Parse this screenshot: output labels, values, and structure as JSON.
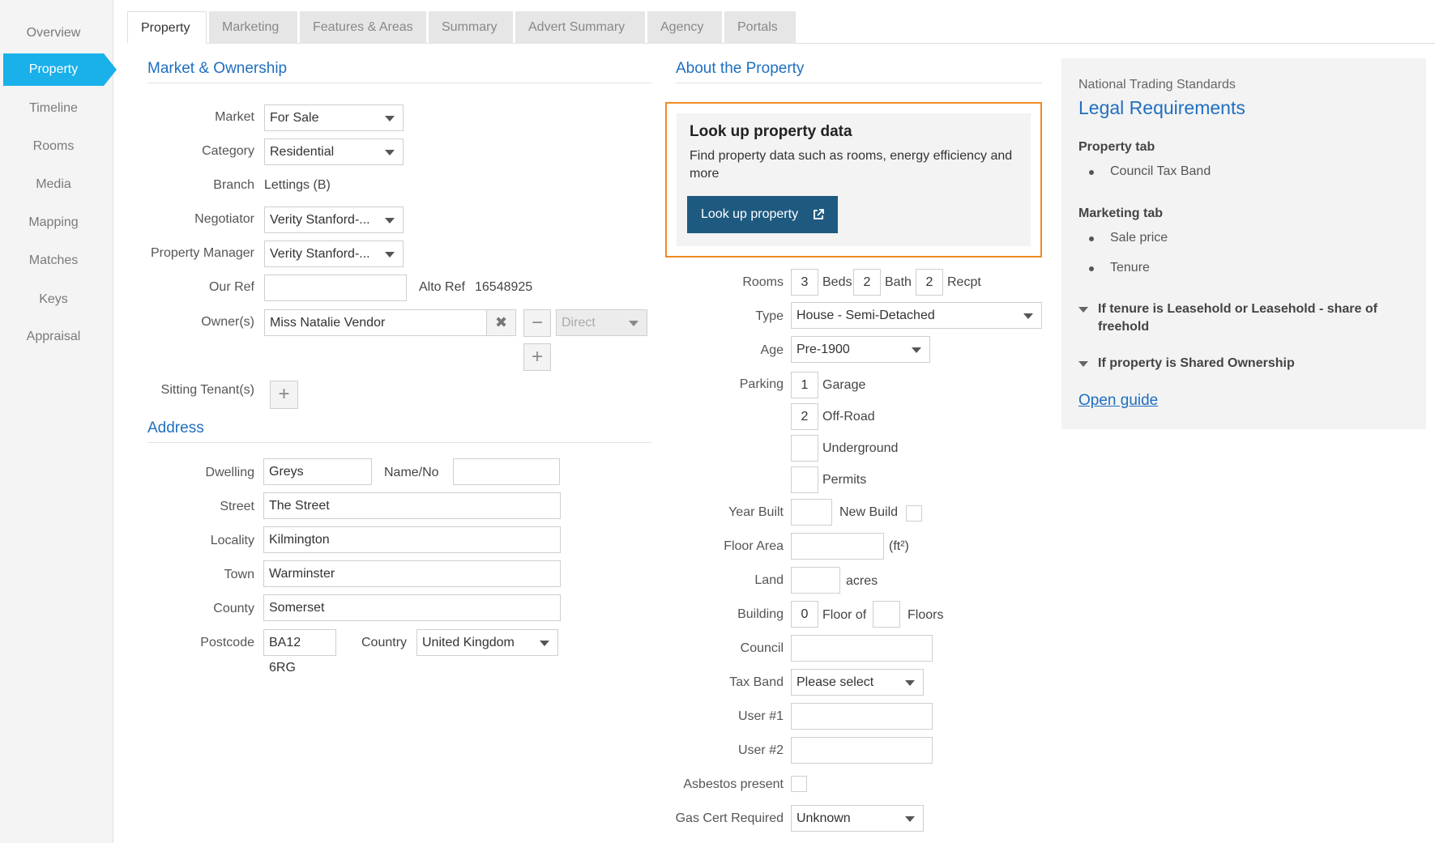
{
  "sidebar": {
    "items": [
      {
        "label": "Overview"
      },
      {
        "label": "Property"
      },
      {
        "label": "Timeline"
      },
      {
        "label": "Rooms"
      },
      {
        "label": "Media"
      },
      {
        "label": "Mapping"
      },
      {
        "label": "Matches"
      },
      {
        "label": "Keys"
      },
      {
        "label": "Appraisal"
      }
    ],
    "active": "Property"
  },
  "tabs": [
    {
      "label": "Property"
    },
    {
      "label": "Marketing"
    },
    {
      "label": "Features & Areas"
    },
    {
      "label": "Summary"
    },
    {
      "label": "Advert Summary"
    },
    {
      "label": "Agency"
    },
    {
      "label": "Portals"
    }
  ],
  "market_ownership": {
    "title": "Market & Ownership",
    "market_label": "Market",
    "market_value": "For Sale",
    "category_label": "Category",
    "category_value": "Residential",
    "branch_label": "Branch",
    "branch_value": "Lettings (B)",
    "negotiator_label": "Negotiator",
    "negotiator_value": "Verity Stanford-...",
    "manager_label": "Property Manager",
    "manager_value": "Verity Stanford-...",
    "our_ref_label": "Our Ref",
    "our_ref_value": "",
    "alto_ref_label": "Alto Ref",
    "alto_ref_value": "16548925",
    "owners_label": "Owner(s)",
    "owner_value": "Miss Natalie Vendor",
    "owner_type": "Direct",
    "sitting_tenants_label": "Sitting Tenant(s)"
  },
  "address": {
    "title": "Address",
    "dwelling_label": "Dwelling",
    "dwelling_value": "Greys",
    "name_no_label": "Name/No",
    "name_no_value": "",
    "street_label": "Street",
    "street_value": "The Street",
    "locality_label": "Locality",
    "locality_value": "Kilmington",
    "town_label": "Town",
    "town_value": "Warminster",
    "county_label": "County",
    "county_value": "Somerset",
    "postcode_label": "Postcode",
    "postcode_value": "BA12 6RG",
    "country_label": "Country",
    "country_value": "United Kingdom"
  },
  "about": {
    "title": "About the Property",
    "lookup": {
      "title": "Look up property data",
      "description": "Find property data such as rooms, energy efficiency and more",
      "button": "Look up property"
    },
    "rooms_label": "Rooms",
    "beds_value": "3",
    "beds_label": "Beds",
    "bath_value": "2",
    "bath_label": "Bath",
    "recpt_value": "2",
    "recpt_label": "Recpt",
    "type_label": "Type",
    "type_value": "House - Semi-Detached",
    "age_label": "Age",
    "age_value": "Pre-1900",
    "parking_label": "Parking",
    "garage_value": "1",
    "garage_label": "Garage",
    "offroad_value": "2",
    "offroad_label": "Off-Road",
    "underground_value": "",
    "underground_label": "Underground",
    "permits_value": "",
    "permits_label": "Permits",
    "year_built_label": "Year Built",
    "year_built_value": "",
    "new_build_label": "New Build",
    "floor_area_label": "Floor Area",
    "floor_area_value": "",
    "floor_area_unit": "(ft²)",
    "land_label": "Land",
    "land_value": "",
    "land_unit": "acres",
    "building_label": "Building",
    "building_floor_value": "0",
    "floor_of_label": "Floor of",
    "floors_value": "",
    "floors_label": "Floors",
    "council_label": "Council",
    "council_value": "",
    "tax_band_label": "Tax Band",
    "tax_band_value": "Please select",
    "user1_label": "User #1",
    "user1_value": "",
    "user2_label": "User #2",
    "user2_value": "",
    "asbestos_label": "Asbestos present",
    "gas_cert_label": "Gas Cert Required",
    "gas_cert_value": "Unknown"
  },
  "legal": {
    "kicker": "National Trading Standards",
    "title": "Legal Requirements",
    "property_tab": "Property tab",
    "property_items": [
      "Council Tax Band"
    ],
    "marketing_tab": "Marketing tab",
    "marketing_items": [
      "Sale price",
      "Tenure"
    ],
    "toggle1": "If tenure is Leasehold or Leasehold - share of freehold",
    "toggle2": "If property is Shared Ownership",
    "link": "Open guide"
  },
  "colors": {
    "accent": "#1ab0ea",
    "link": "#1f6fbf",
    "highlight": "#f08a24",
    "button": "#1e5a80"
  }
}
